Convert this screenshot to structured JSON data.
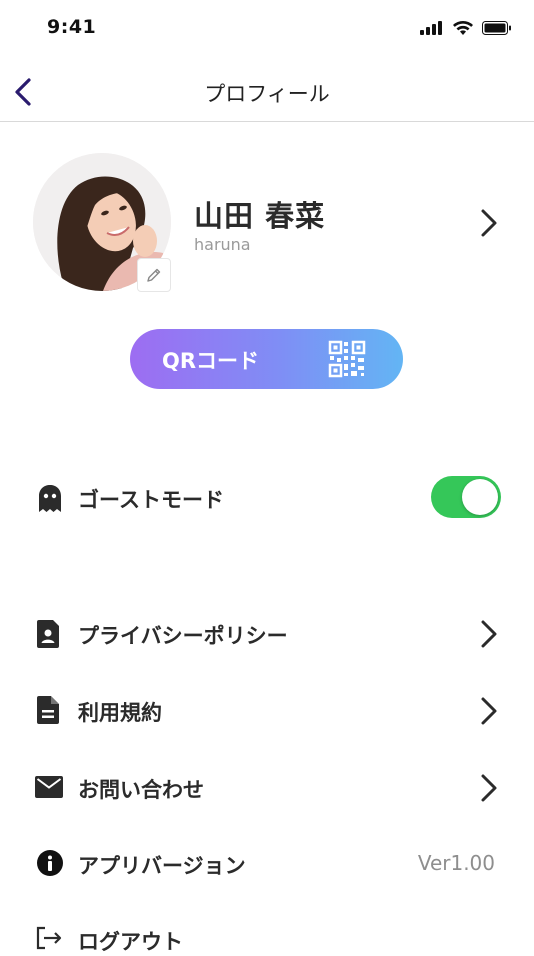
{
  "status_bar": {
    "time": "9:41",
    "icons": [
      "cellular-signal-icon",
      "wifi-icon",
      "battery-icon"
    ]
  },
  "nav": {
    "back_icon": "chevron-left-icon",
    "title": "プロフィール"
  },
  "profile": {
    "name": "山田 春菜",
    "username": "haruna",
    "avatar_icon": "avatar",
    "edit_icon": "pencil-icon",
    "chevron_icon": "chevron-right-icon"
  },
  "qr_button": {
    "label": "QRコード",
    "icon": "qr-code-icon"
  },
  "ghost_mode": {
    "label": "ゴーストモード",
    "icon": "ghost-icon",
    "enabled": true
  },
  "menu": {
    "privacy_label": "プライバシーポリシー",
    "terms_label": "利用規約",
    "contact_label": "お問い合わせ",
    "version_label": "アプリバージョン",
    "version_value": "Ver1.00",
    "logout_label": "ログアウト"
  },
  "colors": {
    "accent": "#2a1b6e",
    "toggle_on": "#35c759",
    "gradient_start": "#9d6df2",
    "gradient_end": "#63b5f4"
  }
}
